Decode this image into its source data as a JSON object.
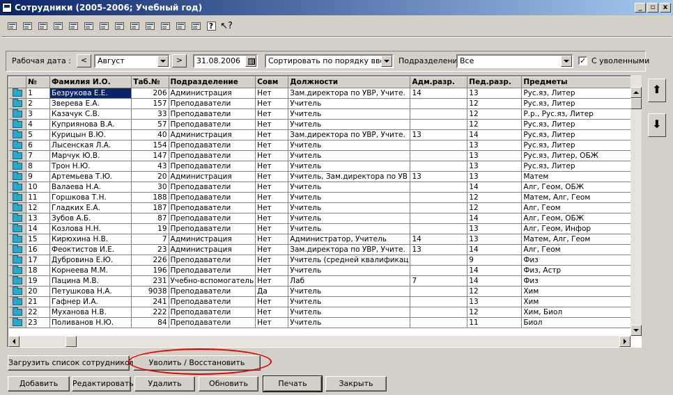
{
  "window": {
    "title": "Сотрудники (2005-2006; Учебный год)",
    "minimize": "_",
    "restore": "▫",
    "close": "x"
  },
  "filter": {
    "work_date_label": "Рабочая дата :",
    "prev": "<",
    "month": "Август",
    "next": ">",
    "date": "31.08.2006",
    "sort": "Сортировать по порядку ввода",
    "division_label": "Подразделение:",
    "division": "Все",
    "fired_check": "✓",
    "fired_label": "С уволенными"
  },
  "table": {
    "columns": [
      "№",
      "Фамилия И.О.",
      "Таб.№",
      "Подразделение",
      "Совм",
      "Должности",
      "Адм.разр.",
      "Пед.разр.",
      "Предметы"
    ],
    "rows": [
      [
        "1",
        "Безрукова Е.Е.",
        "206",
        "Администрация",
        "Нет",
        "Зам.директора по УВР, Учите.",
        "14",
        "13",
        "Рус.яз, Литер"
      ],
      [
        "2",
        "Зверева Е.А.",
        "157",
        "Преподаватели",
        "Нет",
        "Учитель",
        "",
        "12",
        "Рус.яз, Литер"
      ],
      [
        "3",
        "Казачук С.В.",
        "33",
        "Преподаватели",
        "Нет",
        "Учитель",
        "",
        "12",
        "Р.р., Рус.яз, Литер"
      ],
      [
        "4",
        "Куприянова В.А.",
        "57",
        "Преподаватели",
        "Нет",
        "Учитель",
        "",
        "12",
        "Рус.яз, Литер"
      ],
      [
        "5",
        "Курицын В.Ю.",
        "40",
        "Администрация",
        "Нет",
        "Зам.директора по УВР, Учите.",
        "13",
        "14",
        "Рус.яз, Литер"
      ],
      [
        "6",
        "Лысенская Л.А.",
        "154",
        "Преподаватели",
        "Нет",
        "Учитель",
        "",
        "13",
        "Рус.яз, Литер"
      ],
      [
        "7",
        "Марчук Ю.В.",
        "147",
        "Преподаватели",
        "Нет",
        "Учитель",
        "",
        "13",
        "Рус.яз, Литер, ОБЖ"
      ],
      [
        "8",
        "Трон Н.Ю.",
        "43",
        "Преподаватели",
        "Нет",
        "Учитель",
        "",
        "13",
        "Рус.яз, Литер"
      ],
      [
        "9",
        "Артемьева Т.Ю.",
        "20",
        "Администрация",
        "Нет",
        "Учитель, Зам.директора по УВ",
        "13",
        "13",
        "Матем"
      ],
      [
        "10",
        "Валаева Н.А.",
        "30",
        "Преподаватели",
        "Нет",
        "Учитель",
        "",
        "14",
        "Алг, Геом, ОБЖ"
      ],
      [
        "11",
        "Горшкова Т.Н.",
        "188",
        "Преподаватели",
        "Нет",
        "Учитель",
        "",
        "12",
        "Матем, Алг, Геом"
      ],
      [
        "12",
        "Гладких Е.А.",
        "187",
        "Преподаватели",
        "Нет",
        "Учитель",
        "",
        "12",
        "Алг, Геом"
      ],
      [
        "13",
        "Зубов А.Б.",
        "87",
        "Преподаватели",
        "Нет",
        "Учитель",
        "",
        "14",
        "Алг, Геом, ОБЖ"
      ],
      [
        "14",
        "Козлова Н.Н.",
        "19",
        "Преподаватели",
        "Нет",
        "Учитель",
        "",
        "13",
        "Алг, Геом, Инфор"
      ],
      [
        "15",
        "Кирюхина Н.В.",
        "7",
        "Администрация",
        "Нет",
        "Администратор, Учитель",
        "14",
        "13",
        "Матем, Алг, Геом"
      ],
      [
        "16",
        "Феоктистов И.Е.",
        "23",
        "Администрация",
        "Нет",
        "Зам.директора по УВР, Учите.",
        "13",
        "14",
        "Алг, Геом"
      ],
      [
        "17",
        "Дубровина Е.Ю.",
        "226",
        "Преподаватели",
        "Нет",
        "Учитель (средней квалификац",
        "",
        "9",
        "Физ"
      ],
      [
        "18",
        "Корнеева М.М.",
        "196",
        "Преподаватели",
        "Нет",
        "Учитель",
        "",
        "14",
        "Физ, Астр"
      ],
      [
        "19",
        "Пацина М.В.",
        "231",
        "Учебно-вспомогатель",
        "Нет",
        "Лаб",
        "7",
        "14",
        "Физ"
      ],
      [
        "20",
        "Петушкова Н.А.",
        "9038",
        "Преподаватели",
        "Да",
        "Учитель",
        "",
        "12",
        "Хим"
      ],
      [
        "21",
        "Гафнер И.А.",
        "241",
        "Преподаватели",
        "Нет",
        "Учитель",
        "",
        "13",
        "Хим"
      ],
      [
        "22",
        "Муханова Н.В.",
        "222",
        "Преподаватели",
        "Нет",
        "Учитель",
        "",
        "12",
        "Хим, Биол"
      ],
      [
        "23",
        "Поливанов Н.Ю.",
        "84",
        "Преподаватели",
        "Нет",
        "Учитель",
        "",
        "11",
        "Биол"
      ]
    ]
  },
  "side": {
    "up": "⬆",
    "down": "⬇"
  },
  "buttons": {
    "load": "Загрузить список сотрудников",
    "fire": "Уволить / Восстановить",
    "add": "Добавить",
    "edit": "Редактировать",
    "delete": "Удалить",
    "refresh": "Обновить",
    "print": "Печать",
    "close": "Закрыть"
  },
  "toolbar_icons": [
    "grid-icon",
    "edit-grid-icon",
    "find-icon",
    "grid-icon",
    "delete-grid-icon",
    "columns-icon",
    "columns-icon",
    "columns-icon",
    "copy-icon",
    "forward-icon",
    "wrench-icon",
    "copy-icon",
    "monitor-icon",
    "help-icon",
    "context-help-icon"
  ],
  "toolbar_help": "?",
  "toolbar_context_help": "↖?",
  "colors": {
    "title_start": "#0a246a",
    "title_end": "#a6caf0",
    "selection": "#0a246a",
    "annotation": "#e00000",
    "folder": "#2aa7c9"
  }
}
